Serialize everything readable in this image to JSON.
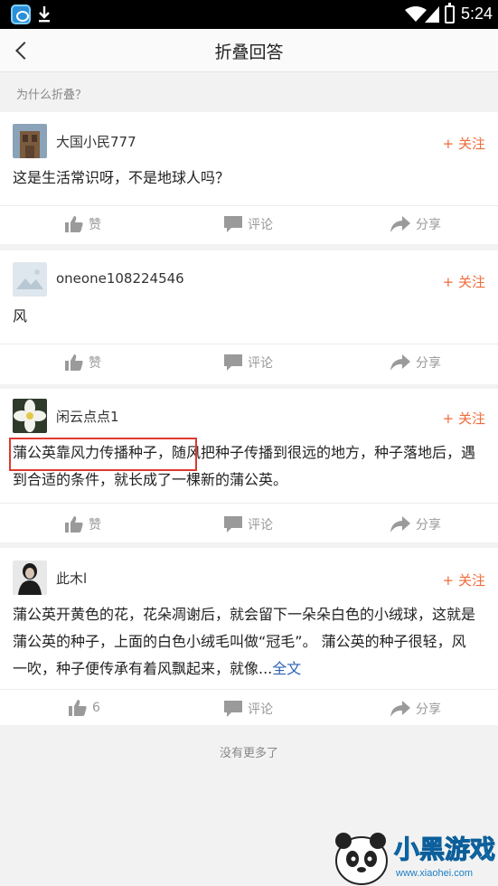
{
  "status_bar": {
    "time": "5:24"
  },
  "nav": {
    "title": "折叠回答"
  },
  "why_folded": "为什么折叠？",
  "answers": [
    {
      "username": "大国小民777",
      "follow": "+ 关注",
      "content": "这是生活常识呀，不是地球人吗？",
      "actions": {
        "like": "赞",
        "comment": "评论",
        "share": "分享"
      }
    },
    {
      "username": "oneone108224546",
      "follow": "+ 关注",
      "content": "风",
      "actions": {
        "like": "赞",
        "comment": "评论",
        "share": "分享"
      }
    },
    {
      "username": "闲云点点1",
      "follow": "+ 关注",
      "content": "蒲公英靠风力传播种子，随风把种子传播到很远的地方，种子落地后，遇到合适的条件，就长成了一棵新的蒲公英。",
      "actions": {
        "like": "赞",
        "comment": "评论",
        "share": "分享"
      }
    },
    {
      "username": "此木l",
      "follow": "+ 关注",
      "content": "蒲公英开黄色的花，花朵凋谢后，就会留下一朵朵白色的小绒球，这就是蒲公英的种子，上面的白色小绒毛叫做“冠毛”。 蒲公英的种子很轻，风一吹，种子便传承有着风飘起来，就像...",
      "more": "全文",
      "actions": {
        "like": "6",
        "comment": "评论",
        "share": "分享"
      }
    }
  ],
  "no_more": "没有更多了",
  "watermark": {
    "brand": "小黑游戏",
    "url": "www.xiaohei.com"
  },
  "colors": {
    "accent": "#f06a3a",
    "link": "#2e62b5",
    "highlight": "#e0382f"
  }
}
